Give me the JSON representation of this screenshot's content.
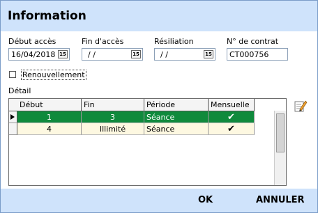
{
  "title": "Information",
  "fields": {
    "debut_label": "Début accès",
    "debut_value": "16/04/2018",
    "fin_label": "Fin d'accès",
    "fin_value": "/ /",
    "resiliation_label": "Résiliation",
    "resiliation_value": "/ /",
    "contrat_label": "N° de contrat",
    "contrat_value": "CT000756",
    "calendar_glyph": "15"
  },
  "renouvellement": {
    "label": "Renouvellement",
    "checked": false
  },
  "detail": {
    "label": "Détail",
    "columns": [
      "Début",
      "Fin",
      "Période",
      "Mensuelle"
    ],
    "rows": [
      {
        "debut": "1",
        "fin": "3",
        "periode": "Séance",
        "mensuelle": "✔",
        "selected": true
      },
      {
        "debut": "4",
        "fin": "Illimité",
        "periode": "Séance",
        "mensuelle": "✔",
        "selected": false
      }
    ]
  },
  "buttons": {
    "ok": "OK",
    "annuler": "ANNULER"
  },
  "colors": {
    "titlebar": "#cfe3fb",
    "selected_row": "#0f8a3c",
    "row_alt": "#fdf8e1"
  },
  "icons": {
    "calendar": "calendar-icon",
    "edit": "edit-pencil-icon",
    "row_indicator": "row-pointer-icon"
  }
}
